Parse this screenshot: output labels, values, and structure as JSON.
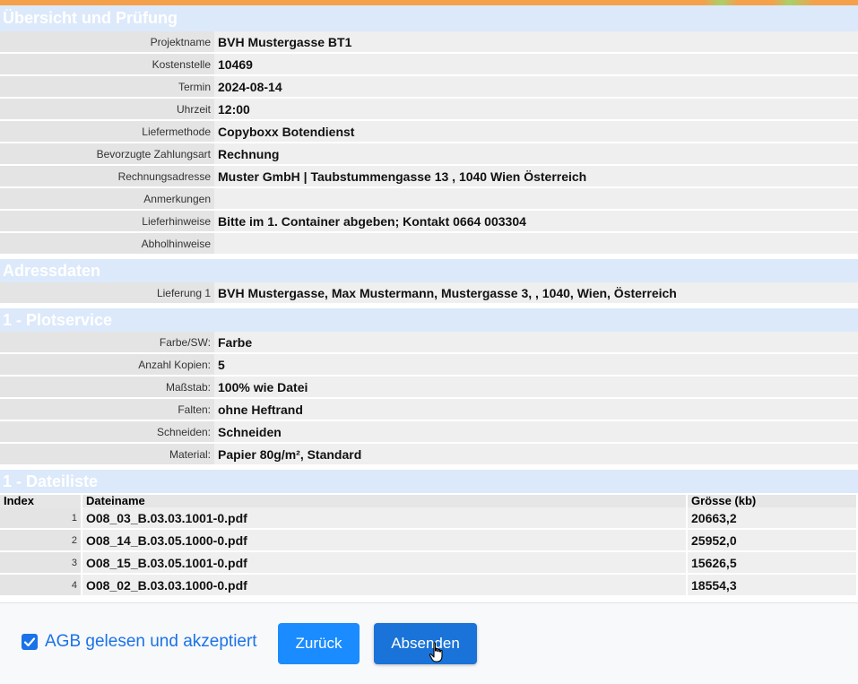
{
  "sections": {
    "overview_title": "Übersicht und Prüfung",
    "address_title": "Adressdaten",
    "plot_title": "1 - Plotservice",
    "files_title": "1 - Dateiliste"
  },
  "overview": [
    {
      "label": "Projektname",
      "value": "BVH Mustergasse BT1"
    },
    {
      "label": "Kostenstelle",
      "value": "10469"
    },
    {
      "label": "Termin",
      "value": "2024-08-14"
    },
    {
      "label": "Uhrzeit",
      "value": "12:00"
    },
    {
      "label": "Liefermethode",
      "value": "Copyboxx Botendienst"
    },
    {
      "label": "Bevorzugte Zahlungsart",
      "value": "Rechnung"
    },
    {
      "label": "Rechnungsadresse",
      "value": "Muster GmbH | Taubstummengasse 13 , 1040 Wien Österreich"
    },
    {
      "label": "Anmerkungen",
      "value": ""
    },
    {
      "label": "Lieferhinweise",
      "value": "Bitte im 1. Container abgeben; Kontakt 0664 003304"
    },
    {
      "label": "Abholhinweise",
      "value": ""
    }
  ],
  "address": [
    {
      "label": "Lieferung 1",
      "value": "BVH Mustergasse, Max Mustermann, Mustergasse 3, , 1040, Wien, Österreich"
    }
  ],
  "plot": [
    {
      "label": "Farbe/SW:",
      "value": "Farbe"
    },
    {
      "label": "Anzahl Kopien:",
      "value": "5"
    },
    {
      "label": "Maßstab:",
      "value": "100% wie Datei"
    },
    {
      "label": "Falten:",
      "value": "ohne Heftrand"
    },
    {
      "label": "Schneiden:",
      "value": "Schneiden"
    },
    {
      "label": "Material:",
      "value": "Papier 80g/m², Standard"
    }
  ],
  "files": {
    "headers": [
      "Index",
      "Dateiname",
      "Grösse (kb)"
    ],
    "rows": [
      {
        "index": "1",
        "name": "O08_03_B.03.03.1001-0.pdf",
        "size": "20663,2"
      },
      {
        "index": "2",
        "name": "O08_14_B.03.05.1000-0.pdf",
        "size": "25952,0"
      },
      {
        "index": "3",
        "name": "O08_15_B.03.05.1001-0.pdf",
        "size": "15626,5"
      },
      {
        "index": "4",
        "name": "O08_02_B.03.03.1000-0.pdf",
        "size": "18554,3"
      }
    ]
  },
  "footer": {
    "agb_label": "AGB gelesen und akzeptiert",
    "agb_checked": true,
    "back_label": "Zurück",
    "send_label": "Absenden"
  },
  "colors": {
    "accent": "#1a73e8",
    "section_bg": "#dce9fb",
    "top_bar": "#f5a04a"
  }
}
